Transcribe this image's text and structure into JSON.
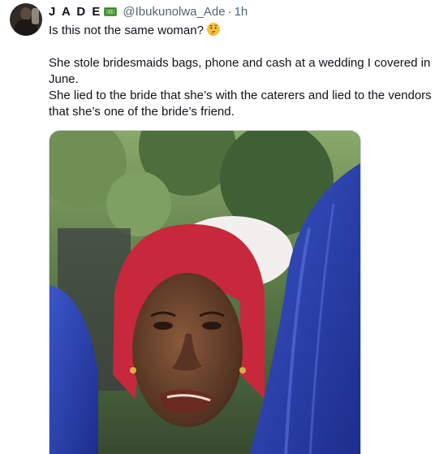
{
  "tweet": {
    "display_name": "J A D E",
    "name_emoji_icon": "money-banknote-icon",
    "handle": "@Ibukunolwa_Ade",
    "separator": "·",
    "time": "1h",
    "lines": [
      "Is this not the same woman?",
      "She stole bridesmaids bags, phone and cash at a wedding I covered in",
      "June.",
      "She lied to the bride that she’s with the caterers and lied to the vendors",
      "that she’s one of the bride’s friend."
    ],
    "first_line_emoji_icon": "thinking-face-icon",
    "media": {
      "description_icon": "photo-woman-red-hair"
    }
  },
  "colors": {
    "text": "#0f1419",
    "secondary": "#536471",
    "border": "#cfd9de"
  }
}
